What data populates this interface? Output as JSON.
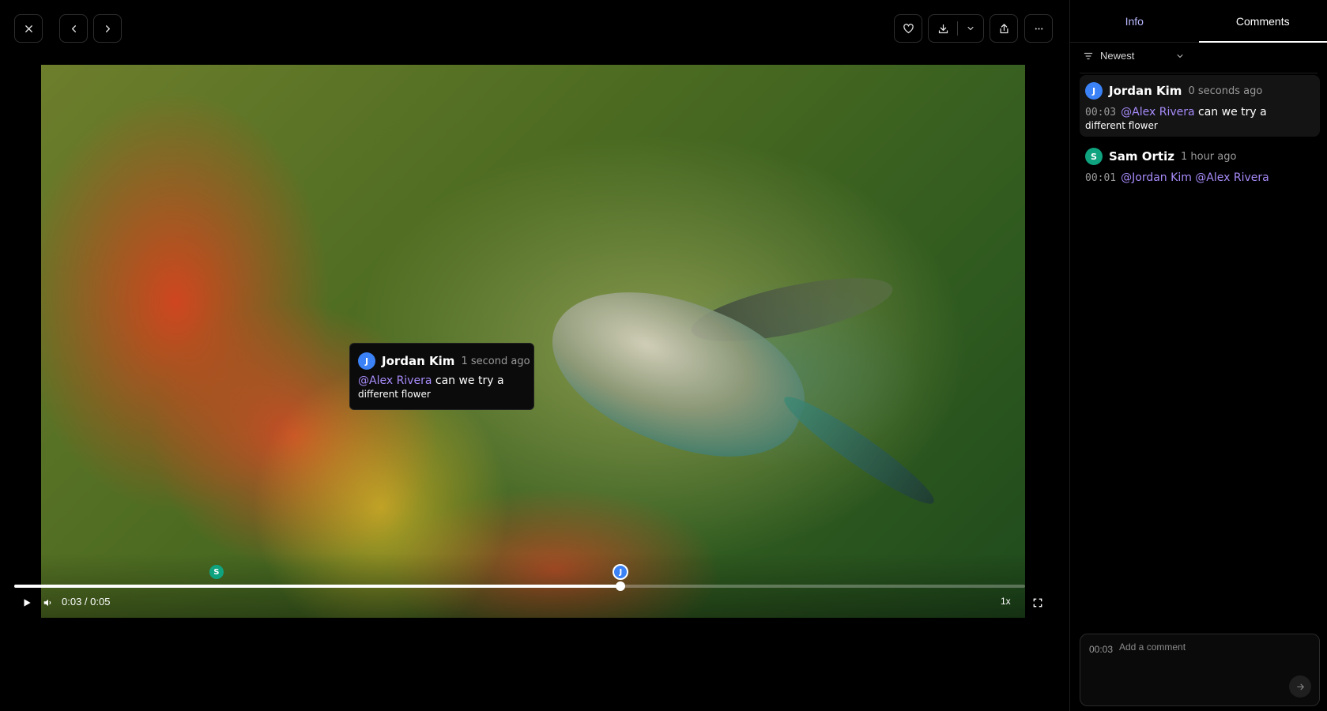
{
  "toolbar": {
    "icons": [
      "close-icon",
      "chevron-left-icon",
      "chevron-right-icon",
      "heart-icon",
      "download-icon",
      "chevron-down-icon",
      "share-icon",
      "more-icon"
    ]
  },
  "player": {
    "current_time": "0:03",
    "duration": "0:05",
    "time_separator": " / ",
    "progress_fraction": 0.6,
    "speed": "1x",
    "markers": [
      {
        "initial": "S",
        "at_seconds": 1,
        "color": "#10a37f",
        "selected": false
      },
      {
        "initial": "J",
        "at_seconds": 3,
        "color": "#3b82f6",
        "selected": true
      }
    ]
  },
  "tooltip": {
    "initial": "J",
    "author": "Jordan Kim",
    "time_ago": "1 second ago",
    "mention": "@Alex Rivera",
    "text": " can we try a",
    "text_cont": "different flower"
  },
  "panel": {
    "tabs": [
      {
        "label": "Info",
        "active": false
      },
      {
        "label": "Comments",
        "active": true
      }
    ],
    "sort_label": "Newest",
    "comments": [
      {
        "initial": "J",
        "avatar_color": "#3b82f6",
        "author": "Jordan Kim",
        "time_ago": "0 seconds ago",
        "timestamp": "00:03",
        "mentions": "@Alex Rivera",
        "text": " can we try a",
        "text_cont": "different flower"
      },
      {
        "initial": "S",
        "avatar_color": "#10a37f",
        "author": "Sam Ortiz",
        "time_ago": "1 hour ago",
        "timestamp": "00:01",
        "mentions": "@Jordan Kim @Alex Rivera",
        "text": "",
        "text_cont": ""
      }
    ],
    "composer": {
      "timestamp": "00:03",
      "placeholder": "Add a comment"
    }
  },
  "colors": {
    "accent": "#3b82f6",
    "mention": "#a78bfa",
    "secondary_avatar": "#10a37f"
  }
}
